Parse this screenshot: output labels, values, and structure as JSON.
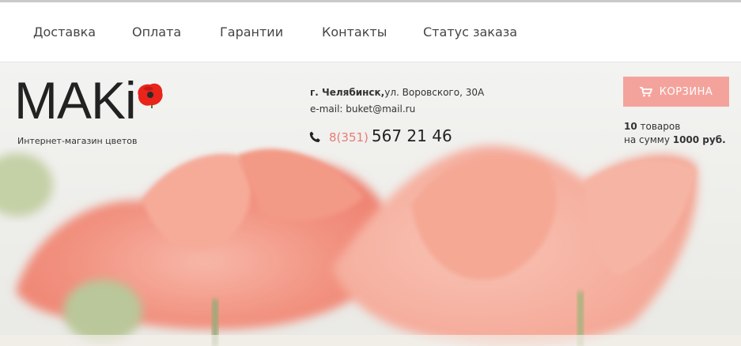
{
  "nav": {
    "items": [
      {
        "label": "Доставка"
      },
      {
        "label": "Оплата"
      },
      {
        "label": "Гарантии"
      },
      {
        "label": "Контакты"
      },
      {
        "label": "Статус заказа"
      }
    ]
  },
  "logo": {
    "text": "MAKi",
    "tagline": "Интернет-магазин цветов"
  },
  "contacts": {
    "city": "г. Челябинск,",
    "street": "ул. Воровского, 30А",
    "email": "e-mail: buket@mail.ru",
    "phone_code": "8(351)",
    "phone_number": "567 21 46"
  },
  "cart": {
    "button_label": "КОРЗИНА",
    "count": "10",
    "count_suffix": " товаров",
    "sum_prefix": "на сумму ",
    "sum": "1000 руб."
  },
  "colors": {
    "accent": "#f4a39c",
    "phone_code": "#e57c73",
    "petal": "#f2917f"
  },
  "icons": [
    "cart-icon",
    "phone-icon",
    "poppy-logo-icon"
  ]
}
